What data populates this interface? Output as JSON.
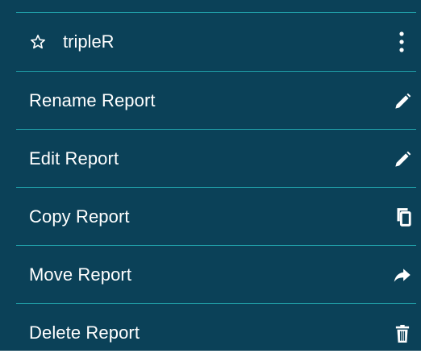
{
  "menu": {
    "favorite": {
      "title": "tripleR",
      "star_icon": "star-outline-icon",
      "more_icon": "more-vertical-icon"
    },
    "items": [
      {
        "label": "Rename Report",
        "icon": "pencil-icon"
      },
      {
        "label": "Edit Report",
        "icon": "pencil-icon"
      },
      {
        "label": "Copy Report",
        "icon": "copy-icon"
      },
      {
        "label": "Move Report",
        "icon": "arrow-right-icon"
      },
      {
        "label": "Delete Report",
        "icon": "trash-icon"
      }
    ]
  },
  "colors": {
    "background": "#0b4158",
    "divider": "#1f9aa4",
    "text": "#ffffff"
  }
}
